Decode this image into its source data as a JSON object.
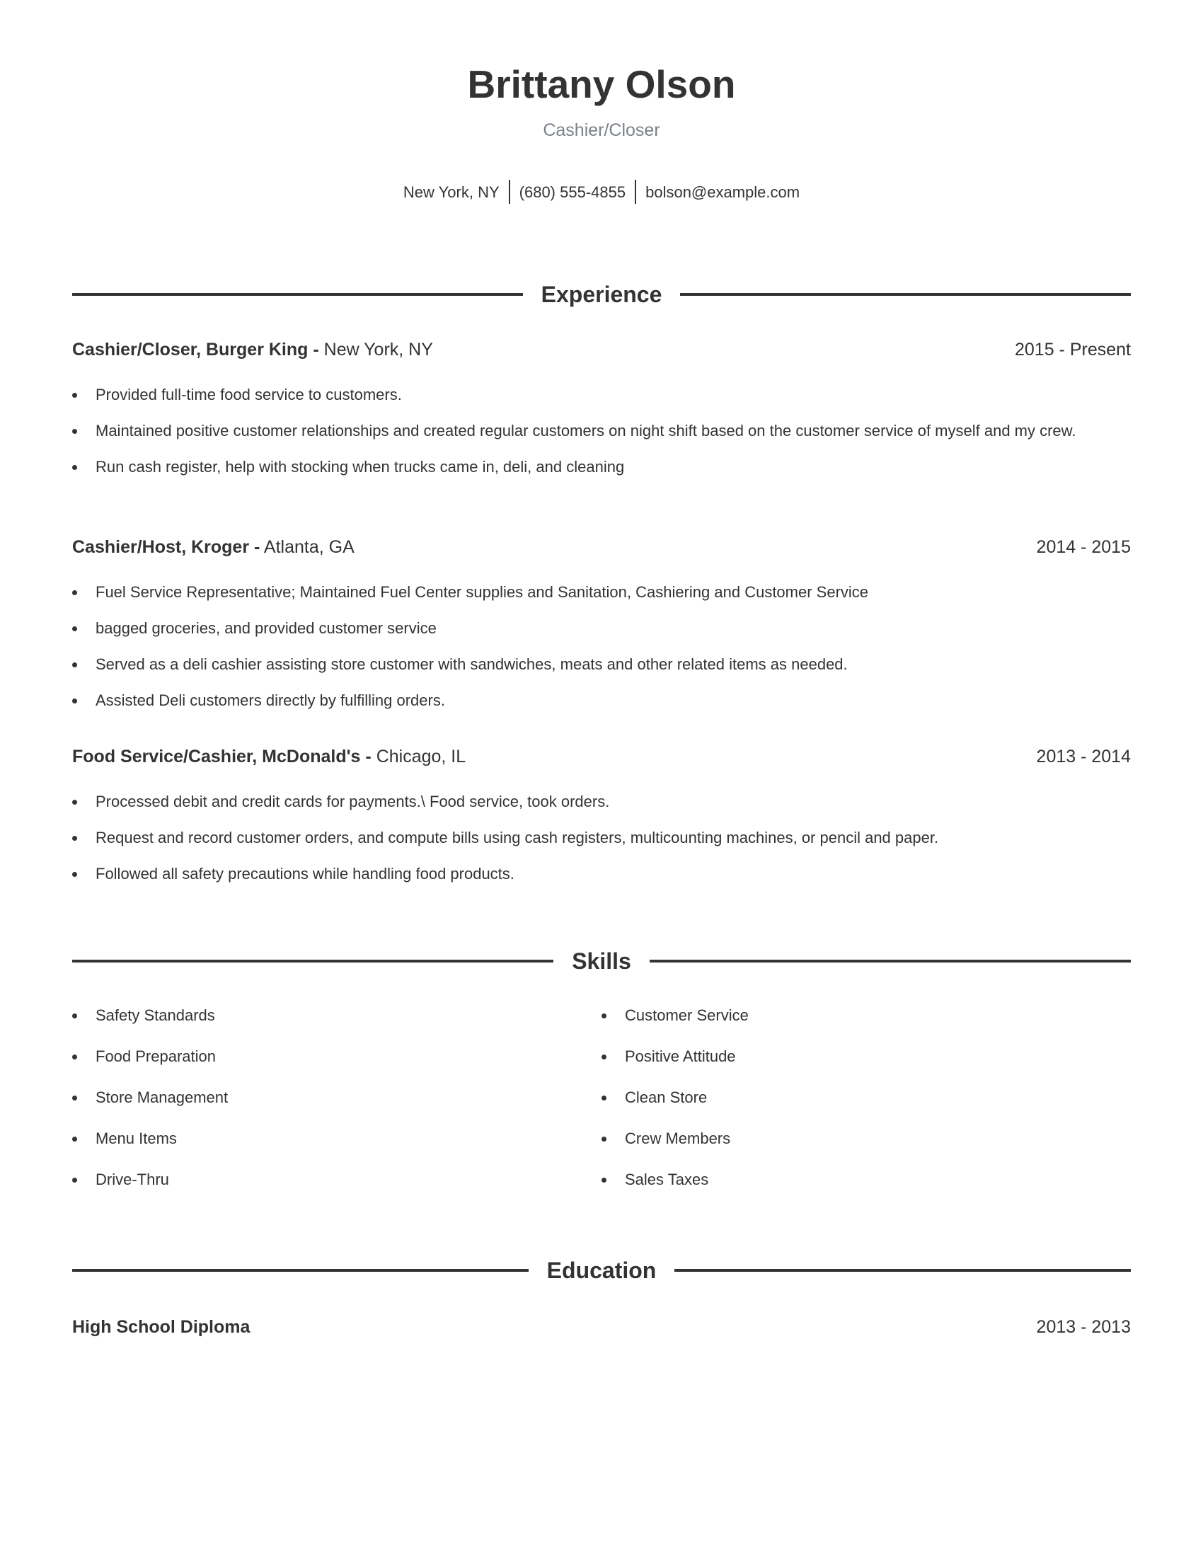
{
  "header": {
    "name": "Brittany Olson",
    "title": "Cashier/Closer",
    "contact": {
      "location": "New York, NY",
      "phone": "(680) 555-4855",
      "email": "bolson@example.com"
    }
  },
  "experience": {
    "heading": "Experience",
    "jobs": [
      {
        "role": "Cashier/Closer, Burger King -",
        "location": "New York, NY",
        "dates": "2015 - Present",
        "bullets": [
          "Provided full-time food service to customers.",
          "Maintained positive customer relationships and created regular customers on night shift based on the customer service of myself and my crew.",
          "Run cash register, help with stocking when trucks came in, deli, and cleaning"
        ]
      },
      {
        "role": "Cashier/Host, Kroger -",
        "location": "Atlanta, GA",
        "dates": "2014 - 2015",
        "bullets": [
          "Fuel Service Representative; Maintained Fuel Center supplies and Sanitation, Cashiering and Customer Service",
          "bagged groceries, and provided customer service",
          "Served as a deli cashier assisting store customer with sandwiches, meats and other related items as needed.",
          "Assisted Deli customers directly by fulfilling orders."
        ]
      },
      {
        "role": "Food Service/Cashier, McDonald's -",
        "location": "Chicago, IL",
        "dates": "2013 - 2014",
        "bullets": [
          "Processed debit and credit cards for payments.\\ Food service, took orders.",
          "Request and record customer orders, and compute bills using cash registers, multicounting machines, or pencil and paper.",
          "Followed all safety precautions while handling food products."
        ]
      }
    ]
  },
  "skills": {
    "heading": "Skills",
    "left": [
      "Safety Standards",
      "Food Preparation",
      "Store Management",
      "Menu Items",
      "Drive-Thru"
    ],
    "right": [
      "Customer Service",
      "Positive Attitude",
      "Clean Store",
      "Crew Members",
      "Sales Taxes"
    ]
  },
  "education": {
    "heading": "Education",
    "entries": [
      {
        "degree": "High School Diploma",
        "dates": "2013 - 2013"
      }
    ]
  }
}
